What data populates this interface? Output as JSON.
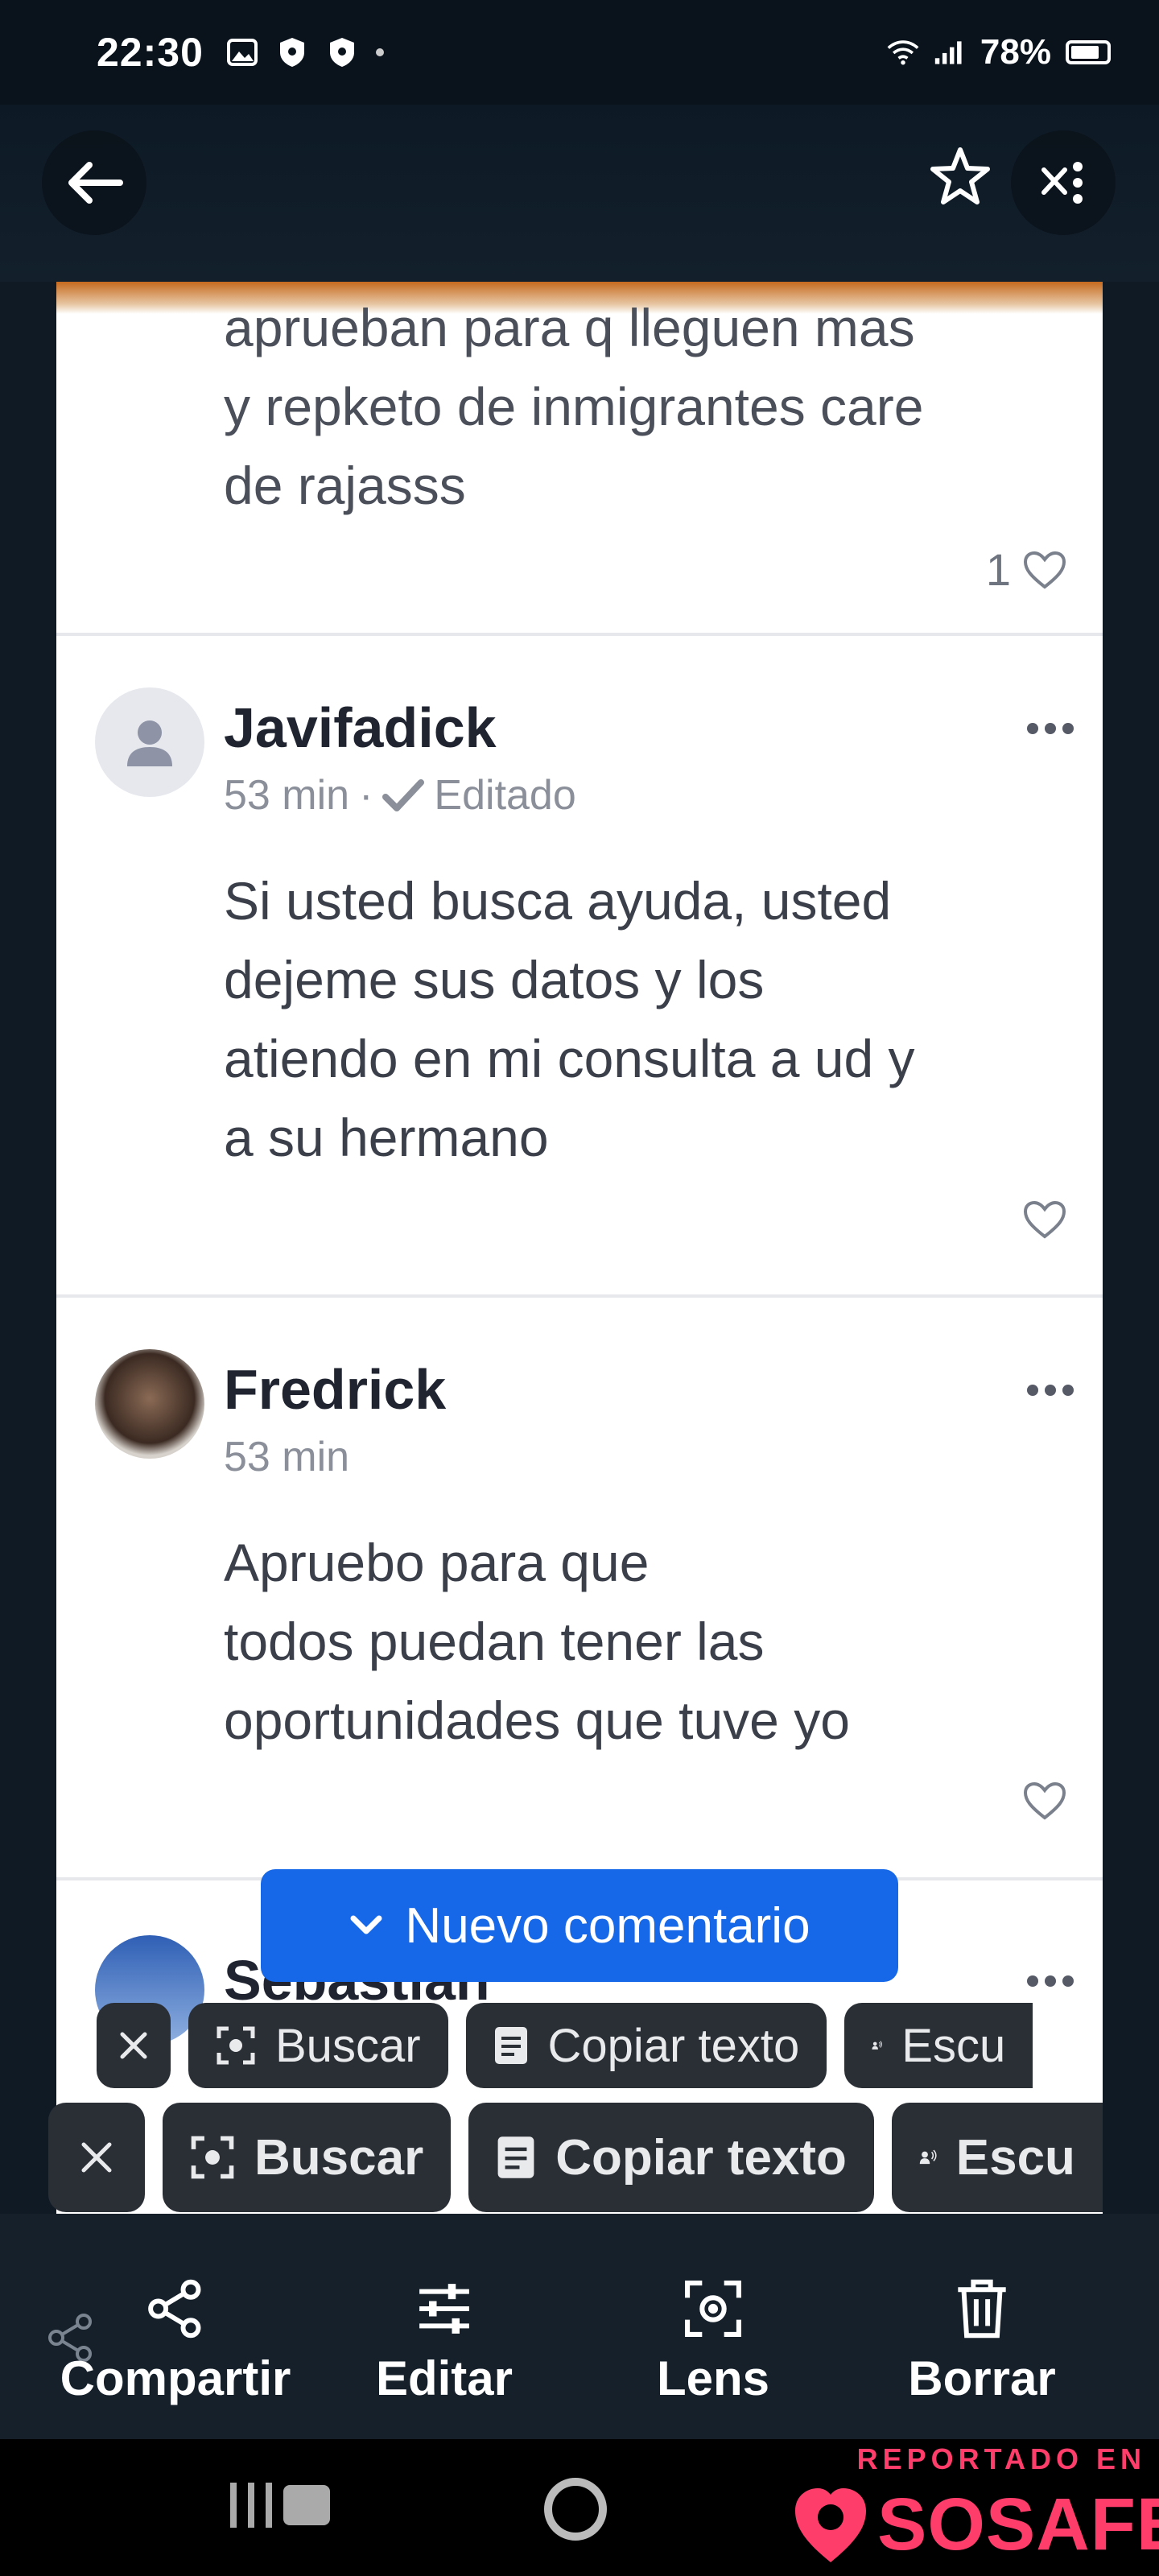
{
  "status_bar": {
    "time": "22:30",
    "battery": "78%"
  },
  "comments": {
    "first": {
      "text_lines": [
        "aprueban para q lleguen mas",
        "y repketo de inmigrantes care",
        "de rajasss"
      ],
      "likes": "1"
    },
    "items": [
      {
        "author": "Javifadick",
        "time": "53 min",
        "separator": "·",
        "edited": "Editado",
        "text_lines": [
          "Si usted busca ayuda, usted",
          "dejeme sus datos y los",
          "atiendo en mi consulta a ud y",
          "a su hermano"
        ]
      },
      {
        "author": "Fredrick",
        "time": "53 min",
        "text_lines": [
          "Apruebo para que",
          "todos puedan tener las",
          "oportunidades que tuve yo"
        ]
      }
    ],
    "partial_author": "Sebastian"
  },
  "new_comment_button": "Nuevo comentario",
  "lens_chips": {
    "search": "Buscar",
    "copy_text": "Copiar texto",
    "listen": "Escu"
  },
  "bottom_actions": {
    "share": "Compartir",
    "edit": "Editar",
    "lens": "Lens",
    "delete": "Borrar"
  },
  "watermark": {
    "top": "REPORTADO EN",
    "brand": "SOSAFE"
  },
  "colors": {
    "accent_blue": "#1668e8",
    "brand_pink": "#ff3d6b"
  }
}
